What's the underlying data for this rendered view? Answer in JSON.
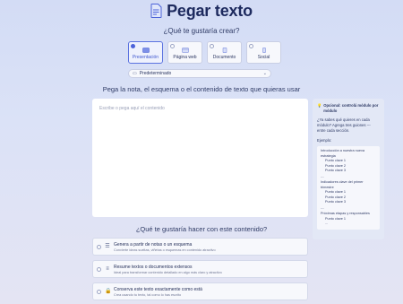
{
  "header": {
    "title": "Pegar texto",
    "icon": "document-icon"
  },
  "question_create": "¿Qué te gustaría crear?",
  "types": [
    {
      "label": "Presentación",
      "icon": "presentation-icon",
      "selected": true
    },
    {
      "label": "Página web",
      "icon": "webpage-icon",
      "selected": false
    },
    {
      "label": "Documento",
      "icon": "document-icon",
      "selected": false
    },
    {
      "label": "Social",
      "icon": "social-icon",
      "selected": false
    }
  ],
  "preset": {
    "label": "Predeterminado",
    "icon": "preset-icon"
  },
  "paste_title": "Pega la nota, el esquema o el contenido de texto que quieras usar",
  "textarea": {
    "placeholder": "Escribe o pega aquí el contenido"
  },
  "side": {
    "heading": "Opcional: controlá módulo por módulo",
    "info": "¿Ya sabes qué quieres en cada módulo? Agrega tres guiones --- entre cada sección.",
    "example_label": "Ejemplo:",
    "example": [
      {
        "heading": "Introducción a nuestra nueva estrategia",
        "items": [
          "Punto clave 1",
          "Punto clave 2",
          "Punto clave 3"
        ]
      },
      {
        "heading": "Indicadores clave del primer trimestre",
        "items": [
          "Punto clave 1",
          "Punto clave 2",
          "Punto clave 3"
        ]
      },
      {
        "heading": "Próximas etapas y responsables",
        "items": [
          "Punto clave 1",
          "..."
        ]
      }
    ],
    "separator": "---"
  },
  "question_do": "¿Qué te gustaría hacer con este contenido?",
  "options": [
    {
      "title": "Genera a partir de notas o un esquema",
      "subtitle": "Convierte ideas sueltas, viñetas o esquemas en contenido atractivo"
    },
    {
      "title": "Resume textos o documentos extensos",
      "subtitle": "Ideal para transformar contenido detallado en algo más claro y atractivo"
    },
    {
      "title": "Conserva este texto exactamente como está",
      "subtitle": "Crea usando tu texto, tal como lo has escrito"
    }
  ]
}
